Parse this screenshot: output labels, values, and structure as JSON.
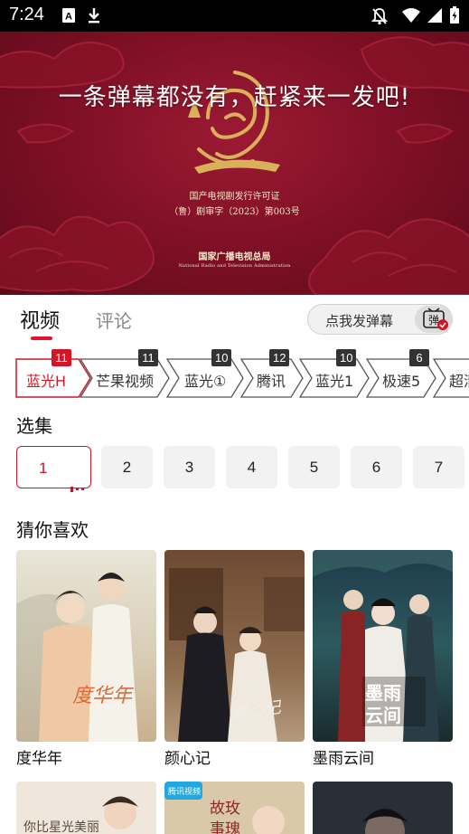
{
  "status_bar": {
    "time": "7:24",
    "left_icons": [
      "a-notification-icon",
      "download-icon"
    ],
    "right_icons": [
      "notifications-off-icon",
      "wifi-icon",
      "signal-icon",
      "battery-icon"
    ]
  },
  "player": {
    "danmaku_placeholder": "一条弹幕都没有，赶紧来一发吧!",
    "license_line_1": "国产电视剧发行许可证",
    "license_line_2": "（鲁）剧审字（2023）第003号",
    "authority_name": "国家广播电视总局",
    "authority_name_en": "National Radio and Television Administration"
  },
  "tabs": {
    "video": "视频",
    "comment": "评论",
    "send_danmaku": "点我发弹幕",
    "danmaku_icon_char": "弹"
  },
  "sources": [
    {
      "label": "蓝光H",
      "badge": "11",
      "active": true
    },
    {
      "label": "芒果视频",
      "badge": "11",
      "active": false
    },
    {
      "label": "蓝光①",
      "badge": "10",
      "active": false
    },
    {
      "label": "腾讯",
      "badge": "12",
      "active": false
    },
    {
      "label": "蓝光1",
      "badge": "10",
      "active": false
    },
    {
      "label": "极速5",
      "badge": "6",
      "active": false
    },
    {
      "label": "超清",
      "badge": "",
      "active": false
    }
  ],
  "episodes": {
    "title": "选集",
    "items": [
      "1",
      "2",
      "3",
      "4",
      "5",
      "6",
      "7"
    ],
    "active_index": 0
  },
  "recommend": {
    "title": "猜你喜欢",
    "items": [
      {
        "name": "度华年",
        "poster_text": "度华年"
      },
      {
        "name": "颜心记",
        "poster_text": "颜心记"
      },
      {
        "name": "墨雨云间",
        "poster_text": "墨雨云间"
      }
    ],
    "second_row": [
      {
        "poster_text": "你比星光美丽"
      },
      {
        "poster_text": "故玫事瑰",
        "badge": "腾讯视频"
      },
      {
        "poster_text": ""
      }
    ]
  },
  "colors": {
    "accent": "#d41525",
    "player_bg": "#7c0f24"
  }
}
